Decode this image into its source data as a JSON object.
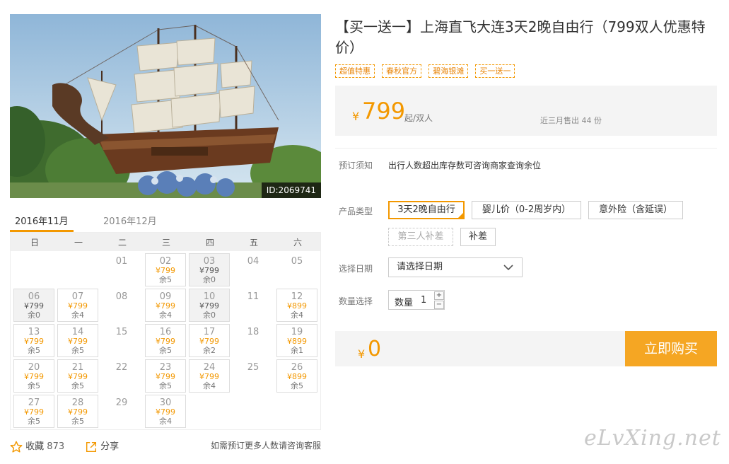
{
  "hero": {
    "id_label": "ID:2069741"
  },
  "calendar": {
    "tabs": [
      "2016年11月",
      "2016年12月"
    ],
    "weekdays": [
      "日",
      "一",
      "二",
      "三",
      "四",
      "五",
      "六"
    ],
    "days": [
      {
        "d": "01"
      },
      {
        "d": "02",
        "price": "¥799",
        "remain": "余5"
      },
      {
        "d": "03",
        "price": "¥799",
        "remain": "余0",
        "sold": true
      },
      {
        "d": "04"
      },
      {
        "d": "05"
      },
      {
        "d": "06",
        "price": "¥799",
        "remain": "余0",
        "sold": true
      },
      {
        "d": "07",
        "price": "¥799",
        "remain": "余4"
      },
      {
        "d": "08"
      },
      {
        "d": "09",
        "price": "¥799",
        "remain": "余4"
      },
      {
        "d": "10",
        "price": "¥799",
        "remain": "余0",
        "sold": true
      },
      {
        "d": "11"
      },
      {
        "d": "12",
        "price": "¥899",
        "remain": "余4"
      },
      {
        "d": "13",
        "price": "¥799",
        "remain": "余5"
      },
      {
        "d": "14",
        "price": "¥799",
        "remain": "余5"
      },
      {
        "d": "15"
      },
      {
        "d": "16",
        "price": "¥799",
        "remain": "余5"
      },
      {
        "d": "17",
        "price": "¥799",
        "remain": "余2"
      },
      {
        "d": "18"
      },
      {
        "d": "19",
        "price": "¥899",
        "remain": "余1"
      },
      {
        "d": "20",
        "price": "¥799",
        "remain": "余5"
      },
      {
        "d": "21",
        "price": "¥799",
        "remain": "余5"
      },
      {
        "d": "22"
      },
      {
        "d": "23",
        "price": "¥799",
        "remain": "余5"
      },
      {
        "d": "24",
        "price": "¥799",
        "remain": "余4"
      },
      {
        "d": "25"
      },
      {
        "d": "26",
        "price": "¥899",
        "remain": "余5"
      },
      {
        "d": "27",
        "price": "¥799",
        "remain": "余5"
      },
      {
        "d": "28",
        "price": "¥799",
        "remain": "余5"
      },
      {
        "d": "29"
      },
      {
        "d": "30",
        "price": "¥799",
        "remain": "余4"
      }
    ]
  },
  "bottom": {
    "favorite_label": "收藏",
    "favorite_count": "873",
    "share_label": "分享",
    "note": "如需预订更多人数请咨询客服"
  },
  "product": {
    "title": "【买一送一】上海直飞大连3天2晚自由行（799双人优惠特价）",
    "tags": [
      "超值特惠",
      "春秋官方",
      "碧海银滩",
      "买一送一"
    ],
    "currency": "¥",
    "price": "799",
    "price_unit": "起/双人",
    "sold_text": "近三月售出 44 份"
  },
  "booking": {
    "notice_label": "预订须知",
    "notice_text": "出行人数超出库存数可咨询商家查询余位",
    "type_label": "产品类型",
    "types": [
      "3天2晚自由行",
      "婴儿价（0-2周岁内）",
      "意外险（含延误）",
      "第三人补差",
      "补差"
    ],
    "date_label": "选择日期",
    "date_placeholder": "请选择日期",
    "qty_label": "数量选择",
    "qty_field_label": "数量",
    "qty_value": "1",
    "qty_plus": "+",
    "qty_minus": "−",
    "total_currency": "¥",
    "total": "0",
    "buy_label": "立即购买"
  },
  "colors": {
    "accent": "#f39800",
    "buy_button": "#f5a623"
  },
  "watermark": "eLvXing.net"
}
